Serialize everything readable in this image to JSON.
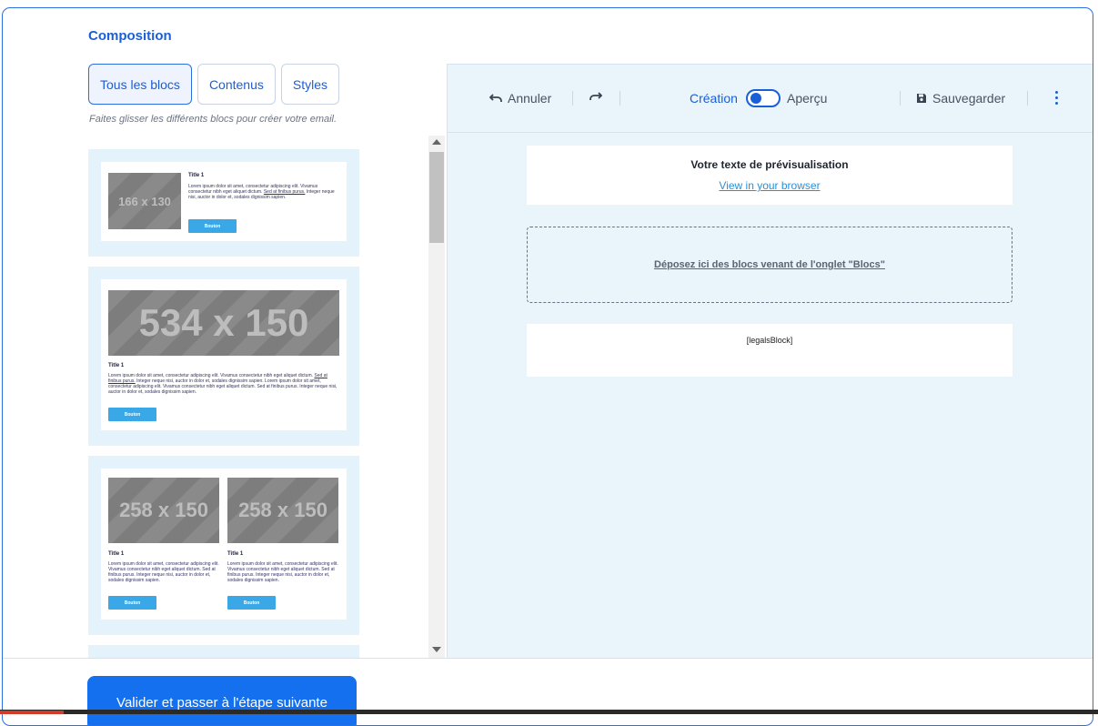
{
  "section_title": "Composition",
  "tabs": [
    {
      "label": "Tous les blocs",
      "active": true
    },
    {
      "label": "Contenus",
      "active": false
    },
    {
      "label": "Styles",
      "active": false
    }
  ],
  "hint": "Faites glisser les différents blocs pour créer votre email.",
  "blocks": [
    {
      "image_label": "166 x 130",
      "title": "Title 1",
      "text_a": "Lorem ipsum dolor sit amet, consectetur adipiscing elit. Vivamus consectetur nibh eget aliquet dictum. ",
      "text_link": "Sed at finibus purus.",
      "text_b": " Integer neque nisi, auctor in dolor et, sodales dignissim sapien.",
      "button": "Bouton"
    },
    {
      "image_label": "534 x 150",
      "title": "Title 1",
      "text_a": "Lorem ipsum dolor sit amet, consectetur adipiscing elit. Vivamus consectetur nibh eget aliquet dictum. ",
      "text_link": "Sed at finibus purus.",
      "text_b": " Integer neque nisi, auctor in dolor et, sodales dignissim sapien. Lorem ipsum dolor sit amet, consectetur adipiscing elit. Vivamus consectetur nibh eget aliquet dictum. Sed at finibus purus. Integer neque nisi, auctor in dolor et, sodales dignissim sapien.",
      "button": "Bouton"
    },
    {
      "columns": [
        {
          "image_label": "258 x 150",
          "title": "Title 1",
          "text": "Lorem ipsum dolor sit amet, consectetur adipiscing elit. Vivamus consectetur nibh eget aliquet dictum. Sed at finibus purus. Integer neque nisi, auctor in dolor et, sodales dignissim sapien.",
          "button": "Bouton"
        },
        {
          "image_label": "258 x 150",
          "title": "Title 1",
          "text": "Lorem ipsum dolor sit amet, consectetur adipiscing elit. Vivamus consectetur nibh eget aliquet dictum. Sed at finibus purus. Integer neque nisi, auctor in dolor et, sodales dignissim sapien.",
          "button": "Bouton"
        }
      ]
    }
  ],
  "toolbar": {
    "undo_label": "Annuler",
    "redo_icon": "redo-icon",
    "mode_left": "Création",
    "mode_right": "Aperçu",
    "save_label": "Sauvegarder"
  },
  "preview": {
    "title": "Votre texte de prévisualisation",
    "link": "View in your browser",
    "dropzone": "Déposez ici des blocs venant de l'onglet \"Blocs\"",
    "legals": "[legalsBlock]"
  },
  "cta_label": "Valider et passer à l'étape suivante",
  "colors": {
    "accent": "#1a5fd8",
    "cta": "#1570ef",
    "editor_bg": "#e9f4fb",
    "block_bg": "#e3f2fb",
    "mini_button": "#3aa7e6"
  }
}
